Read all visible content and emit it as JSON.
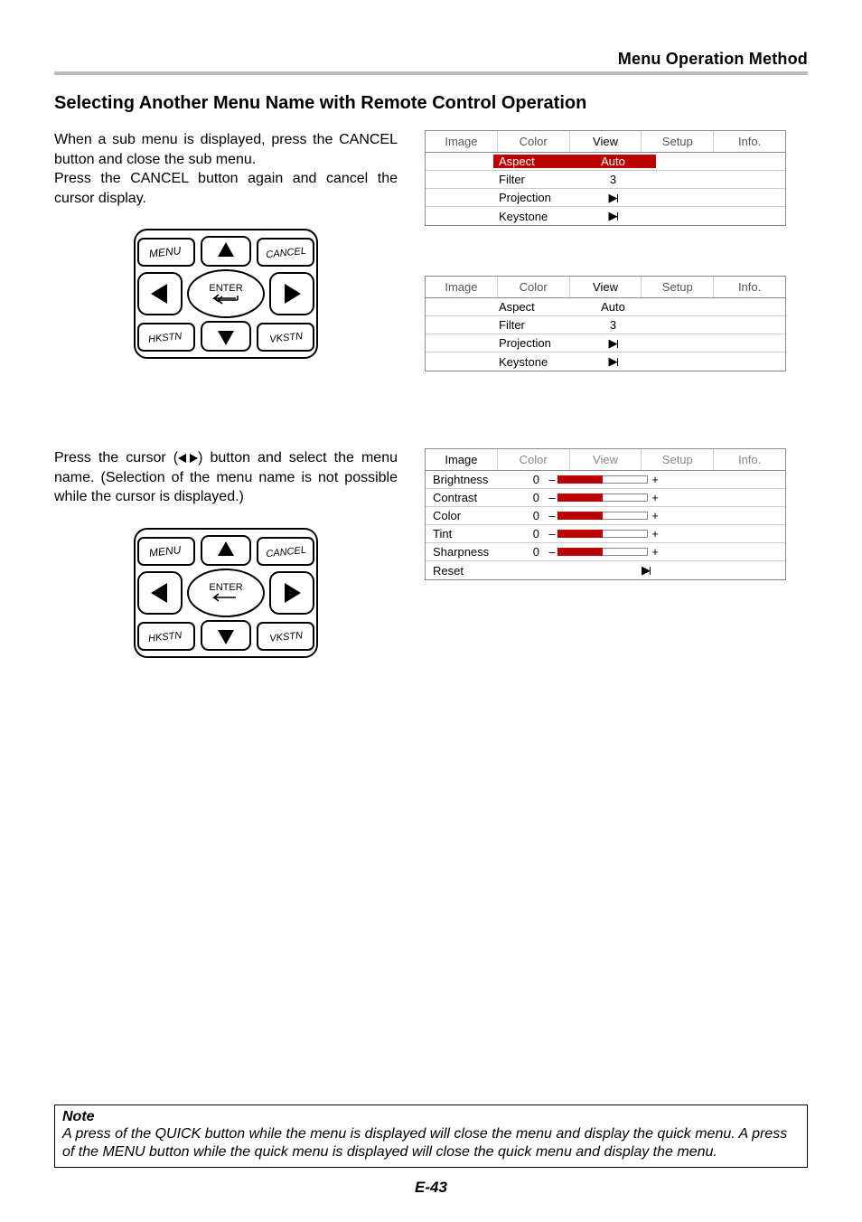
{
  "header_section": "Menu Operation Method",
  "main_heading": "Selecting Another Menu Name with Remote Control Operation",
  "para1a": "When a sub menu is displayed, press the CANCEL button and close the sub menu.",
  "para1b": "Press the CANCEL button again and cancel the cursor display.",
  "para2_pre": "Press the cursor (",
  "para2_post": ") button and select the menu name. (Selection of the menu name is not possible while the cursor is displayed.)",
  "remote": {
    "menu": "MENU",
    "cancel": "CANCEL",
    "enter": "ENTER",
    "hkstn": "HKSTN",
    "vkstn": "VKSTN"
  },
  "tabs": [
    "Image",
    "Color",
    "View",
    "Setup",
    "Info."
  ],
  "view_rows": [
    {
      "label": "Aspect",
      "value": "Auto",
      "type": "text"
    },
    {
      "label": "Filter",
      "value": "3",
      "type": "text"
    },
    {
      "label": "Projection",
      "value": "",
      "type": "arrow"
    },
    {
      "label": "Keystone",
      "value": "",
      "type": "arrow"
    }
  ],
  "image_rows": [
    {
      "label": "Brightness",
      "value": "0"
    },
    {
      "label": "Contrast",
      "value": "0"
    },
    {
      "label": "Color",
      "value": "0"
    },
    {
      "label": "Tint",
      "value": "0"
    },
    {
      "label": "Sharpness",
      "value": "0"
    }
  ],
  "reset_label": "Reset",
  "note_title": "Note",
  "note_body": "A press of the QUICK button while the menu is displayed will close the menu and display the quick menu. A press of the MENU button while the quick menu is displayed will close the quick menu and display the menu.",
  "page_number": "E-43"
}
